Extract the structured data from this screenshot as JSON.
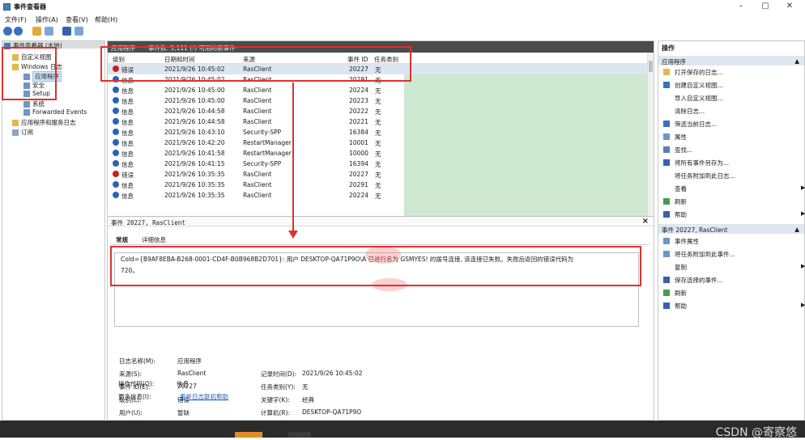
{
  "window": {
    "title": "事件查看器",
    "minimize": "–",
    "maximize": "▢",
    "close": "✕"
  },
  "menu": [
    "文件(F)",
    "操作(A)",
    "查看(V)",
    "帮助(H)"
  ],
  "tree": {
    "root": "事件查看器 (本地)",
    "items": [
      {
        "label": "自定义视图"
      },
      {
        "label": "Windows 日志"
      },
      {
        "label": "应用程序"
      },
      {
        "label": "安全"
      },
      {
        "label": "Setup"
      },
      {
        "label": "系统"
      },
      {
        "label": "Forwarded Events"
      },
      {
        "label": "应用程序和服务日志"
      },
      {
        "label": "订阅"
      }
    ]
  },
  "list": {
    "title": "应用程序",
    "subtitle": "事件数: 5,111 (!) 可用的新事件",
    "columns": {
      "level": "级别",
      "datetime": "日期和时间",
      "source": "来源",
      "event_id": "事件 ID",
      "category": "任务类别"
    },
    "rows": [
      {
        "level": "错误",
        "datetime": "2021/9/26 10:45:02",
        "source": "RasClient",
        "event_id": "20227",
        "category": "无"
      },
      {
        "level": "信息",
        "datetime": "2021/9/26 10:45:02",
        "source": "RasClient",
        "event_id": "20291",
        "category": "无"
      },
      {
        "level": "信息",
        "datetime": "2021/9/26 10:45:00",
        "source": "RasClient",
        "event_id": "20224",
        "category": "无"
      },
      {
        "level": "信息",
        "datetime": "2021/9/26 10:45:00",
        "source": "RasClient",
        "event_id": "20223",
        "category": "无"
      },
      {
        "level": "信息",
        "datetime": "2021/9/26 10:44:58",
        "source": "RasClient",
        "event_id": "20222",
        "category": "无"
      },
      {
        "level": "信息",
        "datetime": "2021/9/26 10:44:58",
        "source": "RasClient",
        "event_id": "20221",
        "category": "无"
      },
      {
        "level": "信息",
        "datetime": "2021/9/26 10:43:10",
        "source": "Security-SPP",
        "event_id": "16384",
        "category": "无"
      },
      {
        "level": "信息",
        "datetime": "2021/9/26 10:42:20",
        "source": "RestartManager",
        "event_id": "10001",
        "category": "无"
      },
      {
        "level": "信息",
        "datetime": "2021/9/26 10:41:58",
        "source": "RestartManager",
        "event_id": "10000",
        "category": "无"
      },
      {
        "level": "信息",
        "datetime": "2021/9/26 10:41:15",
        "source": "Security-SPP",
        "event_id": "16394",
        "category": "无"
      },
      {
        "level": "错误",
        "datetime": "2021/9/26 10:35:35",
        "source": "RasClient",
        "event_id": "20227",
        "category": "无"
      },
      {
        "level": "信息",
        "datetime": "2021/9/26 10:35:35",
        "source": "RasClient",
        "event_id": "20291",
        "category": "无"
      },
      {
        "level": "信息",
        "datetime": "2021/9/26 10:35:35",
        "source": "RasClient",
        "event_id": "20224",
        "category": "无"
      }
    ]
  },
  "detail": {
    "header": "事件 20227, RasClient",
    "tab_general": "常规",
    "tab_details": "详细信息",
    "message_line1": "CoId={B9AF8EBA-B268-0001-CD4F-B0B968B2D701}: 用户 DESKTOP-QA71P9O\\A          已进行名为 GSMYES!  的拨号连接, 该连接已失败。失败后返回的错误代码为",
    "message_line2": "720。",
    "props": {
      "log_name_label": "日志名称(M):",
      "log_name": "应用程序",
      "source_label": "来源(S):",
      "source": "RasClient",
      "logged_label": "记录时间(D):",
      "logged": "2021/9/26 10:45:02",
      "event_id_label": "事件 ID(E):",
      "event_id": "20227",
      "task_label": "任务类别(Y):",
      "task": "无",
      "level_label": "级别(L):",
      "level": "错误",
      "keywords_label": "关键字(K):",
      "keywords": "经典",
      "user_label": "用户(U):",
      "user": "暂缺",
      "computer_label": "计算机(R):",
      "computer": "DESKTOP-QA71P9O",
      "opcode_label": "操作代码(O):",
      "opcode": "信息",
      "more_label": "更多信息(I):",
      "more_link": "事件日志联机帮助"
    }
  },
  "actions": {
    "title": "操作",
    "section1": "应用程序",
    "items1": [
      "打开保存的日志...",
      "创建自定义视图...",
      "导入自定义视图...",
      "清除日志...",
      "筛选当前日志...",
      "属性",
      "查找...",
      "将所有事件另存为...",
      "将任务附加到此日志...",
      "查看",
      "刷新",
      "帮助"
    ],
    "section2": "事件 20227, RasClient",
    "items2": [
      "事件属性",
      "将任务附加到此事件...",
      "复制",
      "保存选择的事件...",
      "刷新",
      "帮助"
    ]
  },
  "watermark": "CSDN @寄察悠",
  "colors": {
    "error": "#cc1f1f",
    "info": "#2a63b8",
    "highlight_green": "#cfe8d2",
    "annotation_red": "#e03030"
  }
}
